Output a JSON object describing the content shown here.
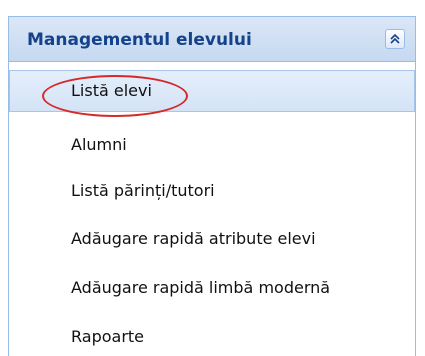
{
  "panel": {
    "title": "Managementul elevului",
    "collapse_icon": "double-chevron-up-icon",
    "items": [
      {
        "label": "Listă elevi",
        "selected": true
      },
      {
        "label": "Alumni"
      },
      {
        "label": "Listă părinți/tutori"
      },
      {
        "label": "Adăugare rapidă atribute elevi"
      },
      {
        "label": "Adăugare rapidă limbă modernă"
      },
      {
        "label": "Rapoarte"
      }
    ]
  },
  "colors": {
    "header_text": "#15428b",
    "border": "#99bbe8",
    "highlight_ellipse": "#d42a2a"
  }
}
